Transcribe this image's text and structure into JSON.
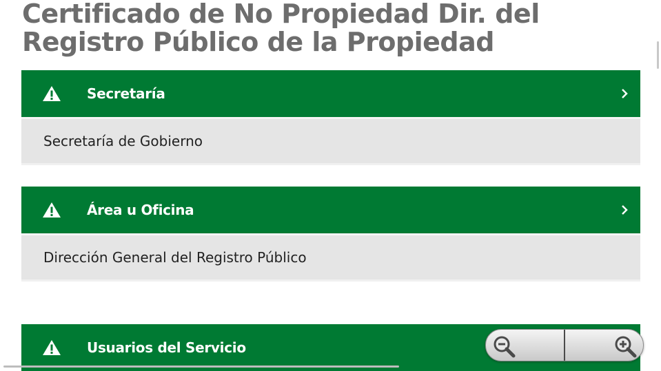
{
  "page": {
    "title": "Certificado de No Propiedad Dir. del Registro Público de la Propiedad"
  },
  "sections": [
    {
      "label": "Secretaría",
      "value": "Secretaría de Gobierno"
    },
    {
      "label": "Área u Oficina",
      "value": "Dirección General del Registro Público"
    },
    {
      "label": "Usuarios del Servicio"
    }
  ],
  "icons": {
    "header_left": "warning-icon",
    "header_right": "chevron-right-icon",
    "zoom_out": "zoom-out-icon",
    "zoom_in": "zoom-in-icon"
  },
  "colors": {
    "header_bg": "#007a33",
    "body_bg": "#e5e5e5",
    "title": "#6d6d6d"
  }
}
